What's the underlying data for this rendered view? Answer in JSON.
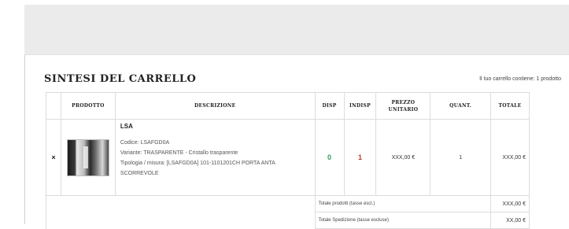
{
  "cart": {
    "title": "SINTESI DEL CARRELLO",
    "summary": "Il tuo carrello contiene: 1 prodotto",
    "columns": {
      "remove": "",
      "product": "PRODOTTO",
      "description": "DESCRIZIONE",
      "disp": "DISP",
      "indisp": "INDISP",
      "unit_price": "PREZZO UNITARIO",
      "quantity": "QUANT.",
      "total": "TOTALE"
    },
    "items": [
      {
        "remove_icon": "×",
        "image_alt": "product-photo",
        "name": "LSA",
        "code": "Codice: LSAFGD0A",
        "variant": "Variante: TRASPARENTE - Cristallo trasparente",
        "type": "Tipologia / misura: [LSAFGD0A] 101-1101201CH PORTA ANTA",
        "type_cont": "SCORREVOLE",
        "disp": "0",
        "indisp": "1",
        "unit_price": "XXX,00 €",
        "quantity": "1",
        "total": "XXX,00 €"
      }
    ],
    "totals": [
      {
        "label": "Totale prodotti (tasse escl.)",
        "amount": "XXX,00 €"
      },
      {
        "label": "Totale Spedizione (tasse escluse)",
        "amount": "XX,00 €"
      }
    ]
  }
}
